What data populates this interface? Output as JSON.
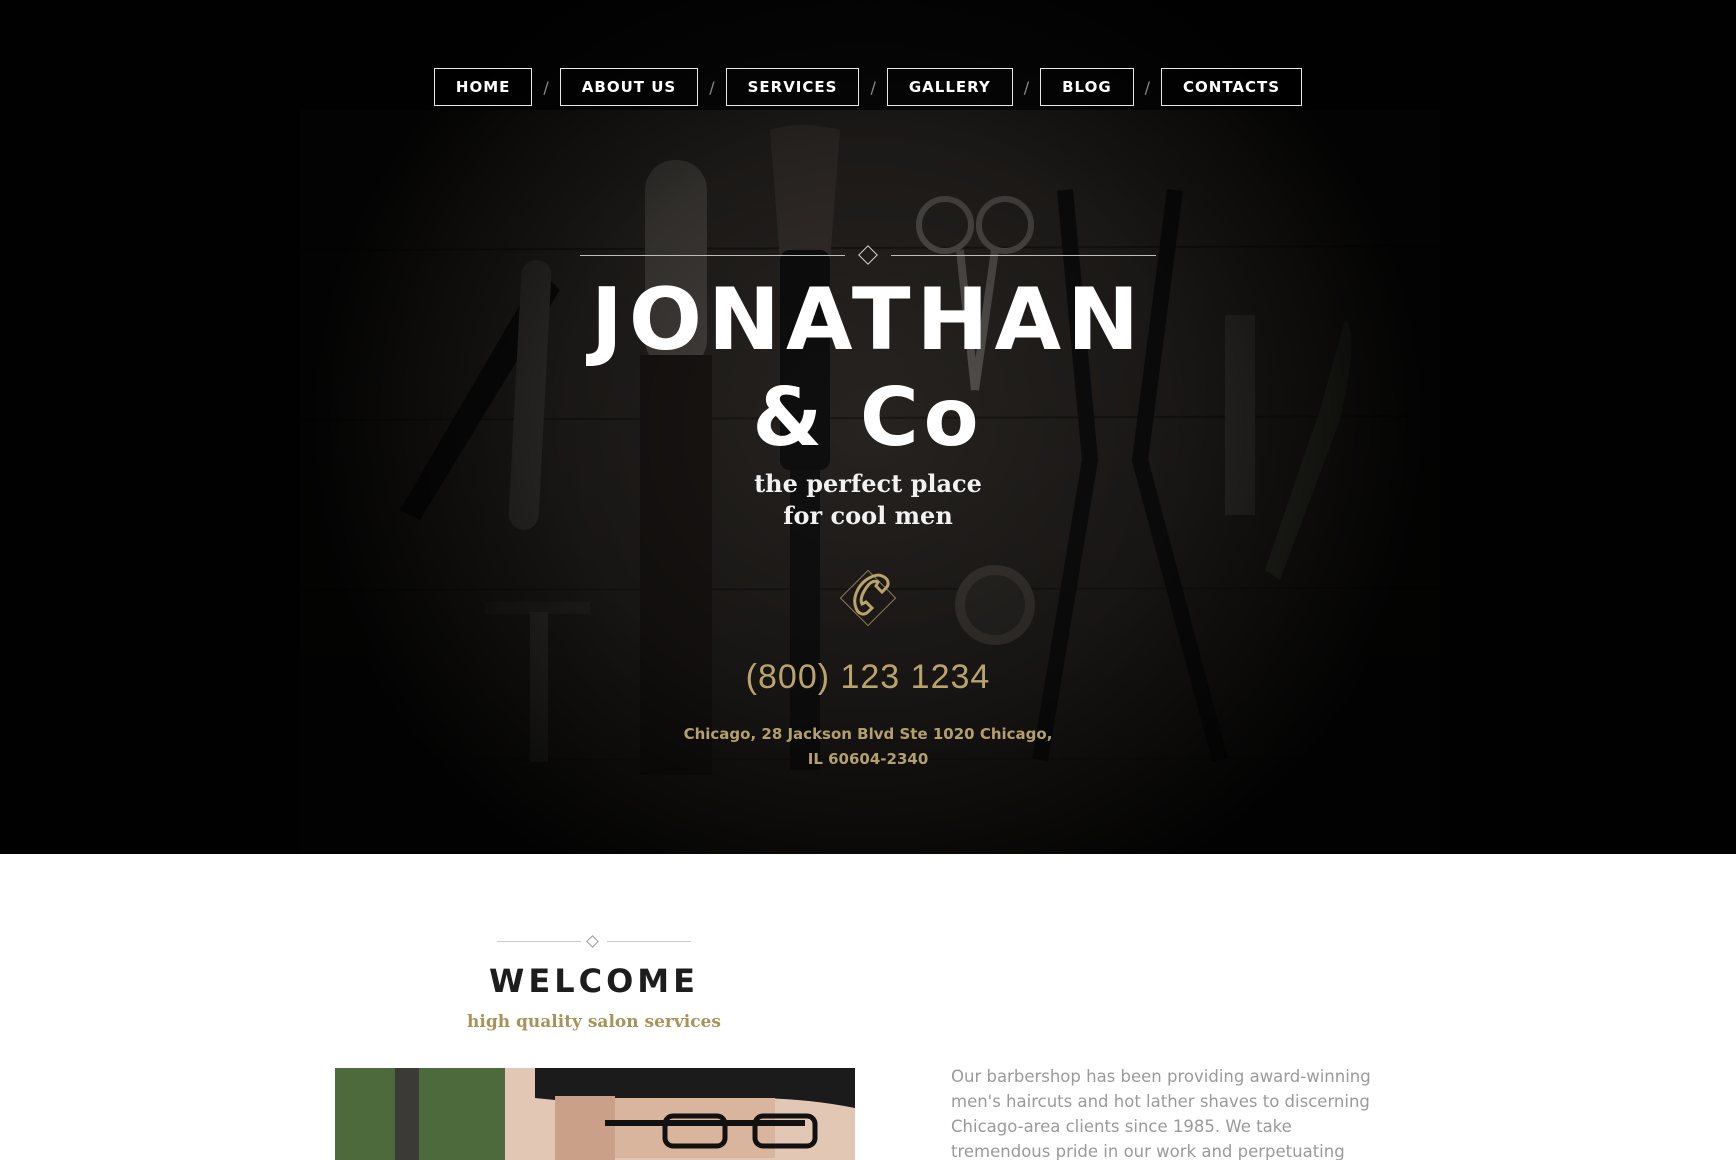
{
  "nav": {
    "items": [
      {
        "label": "HOME"
      },
      {
        "label": "ABOUT US"
      },
      {
        "label": "SERVICES"
      },
      {
        "label": "GALLERY"
      },
      {
        "label": "BLOG"
      },
      {
        "label": "CONTACTS"
      }
    ],
    "separator": "/"
  },
  "hero": {
    "title_line1": "JONATHAN",
    "title_line2": "& Co",
    "tagline_line1": "the perfect place",
    "tagline_line2": "for cool men",
    "phone": "(800) 123 1234",
    "address_line1": "Chicago, 28 Jackson Blvd Ste 1020 Chicago,",
    "address_line2": "IL 60604-2340",
    "icons": [
      "phone-icon"
    ]
  },
  "welcome": {
    "title": "WELCOME",
    "subtitle": "high quality salon services",
    "text_lines": [
      "Our barbershop has been providing award-winning",
      "men's haircuts and hot lather shaves to discerning",
      "Chicago-area clients since 1985. We take",
      "tremendous pride in our work and perpetuating"
    ]
  },
  "colors": {
    "accent_gold": "#b9a46a",
    "hero_bg": "#0a0a0a",
    "text_gray": "#9a9a9a"
  }
}
